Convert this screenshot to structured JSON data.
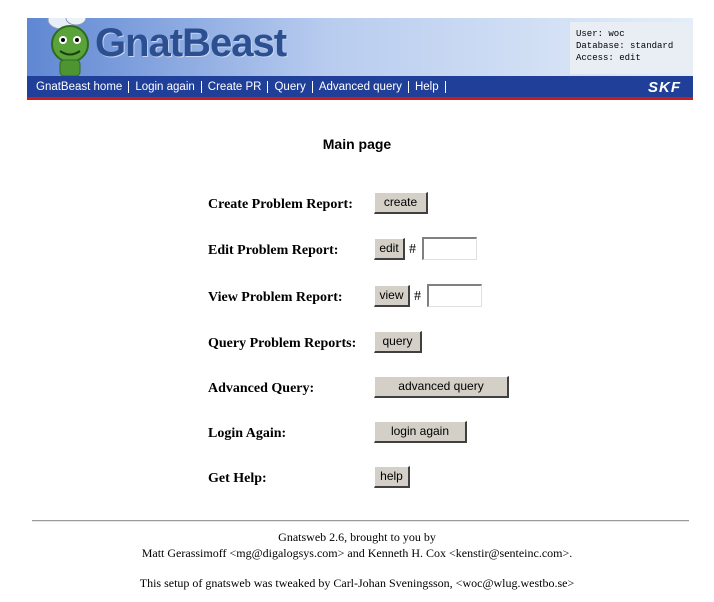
{
  "app": {
    "logo_text": "GnatBeast",
    "user_line": "User: woc",
    "database_line": "Database: standard",
    "access_line": "Access: edit",
    "brand": "SKF"
  },
  "nav": {
    "items": [
      {
        "label": "GnatBeast home"
      },
      {
        "label": "Login again"
      },
      {
        "label": "Create PR"
      },
      {
        "label": "Query"
      },
      {
        "label": "Advanced query"
      },
      {
        "label": "Help"
      }
    ]
  },
  "main": {
    "title": "Main page",
    "rows": {
      "create": {
        "label": "Create Problem Report:",
        "button": "create"
      },
      "edit": {
        "label": "Edit Problem Report:",
        "button": "edit",
        "hash": "#",
        "value": ""
      },
      "view": {
        "label": "View Problem Report:",
        "button": "view",
        "hash": "#",
        "value": ""
      },
      "query": {
        "label": "Query Problem Reports:",
        "button": "query"
      },
      "advanced": {
        "label": "Advanced Query:",
        "button": "advanced query"
      },
      "login": {
        "label": "Login Again:",
        "button": "login again"
      },
      "help": {
        "label": "Get Help:",
        "button": "help"
      }
    }
  },
  "footer": {
    "line1": "Gnatsweb 2.6, brought to you by",
    "line2": "Matt Gerassimoff <mg@digalogsys.com> and Kenneth H. Cox <kenstir@senteinc.com>.",
    "line3": "This setup of gnatsweb was tweaked by Carl-Johan Sveningsson, <woc@wlug.westbo.se>"
  },
  "colors": {
    "nav_bg": "#1f3f99",
    "nav_underline": "#cc1b1b",
    "logo_text": "#2b4f91",
    "button_face": "#d4d0c8"
  }
}
